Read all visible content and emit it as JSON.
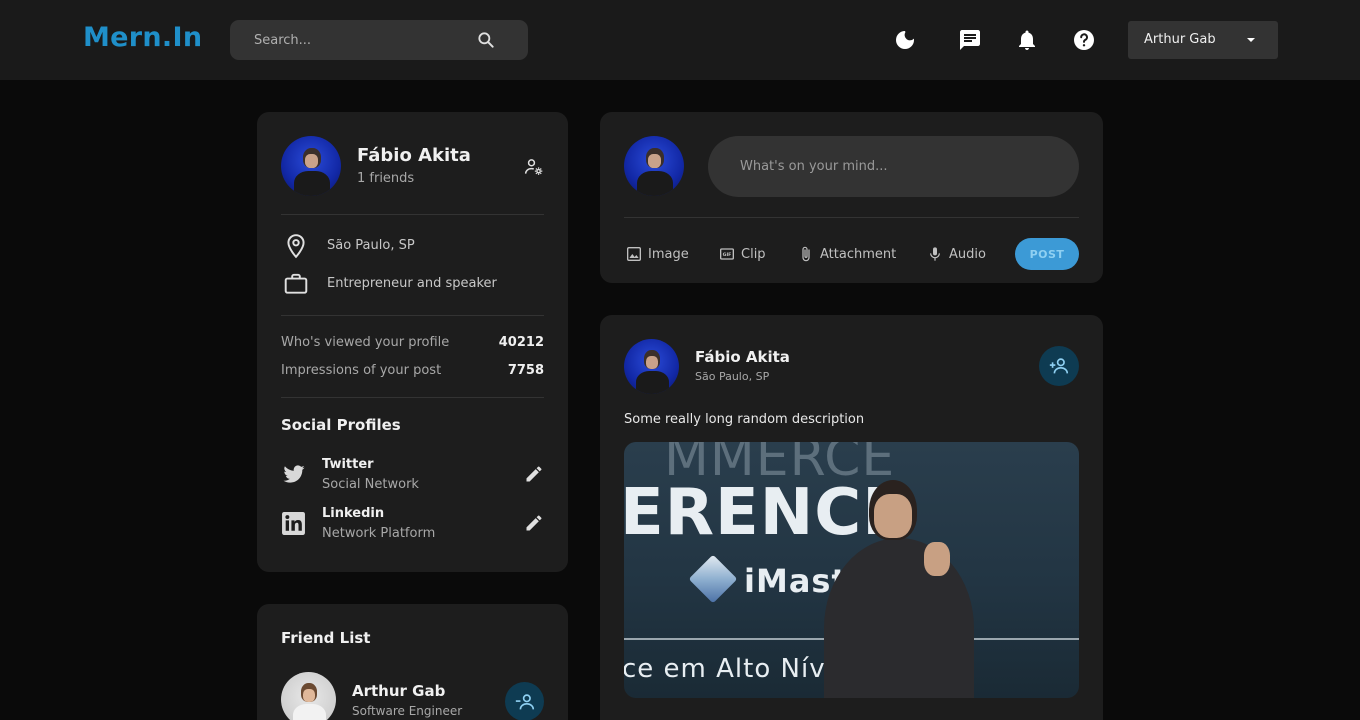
{
  "app": {
    "logo": "Mern.In"
  },
  "search": {
    "placeholder": "Search..."
  },
  "user_menu": {
    "selected": "Arthur Gab"
  },
  "profile": {
    "name": "Fábio Akita",
    "friends": "1 friends",
    "location": "São Paulo, SP",
    "occupation": "Entrepreneur and speaker",
    "stats": [
      {
        "label": "Who's viewed your profile",
        "value": "40212"
      },
      {
        "label": "Impressions of your post",
        "value": "7758"
      }
    ],
    "social_title": "Social Profiles",
    "social": [
      {
        "name": "Twitter",
        "type": "Social Network",
        "icon": "twitter-icon"
      },
      {
        "name": "Linkedin",
        "type": "Network Platform",
        "icon": "linkedin-icon"
      }
    ]
  },
  "friend_list": {
    "title": "Friend List",
    "friends": [
      {
        "name": "Arthur Gab",
        "subtitle": "Software Engineer"
      }
    ]
  },
  "composer": {
    "placeholder": "What's on your mind...",
    "actions": [
      "Image",
      "Clip",
      "Attachment",
      "Audio"
    ],
    "post_label": "POST"
  },
  "post": {
    "author": "Fábio Akita",
    "location": "São Paulo, SP",
    "description": "Some really long random description",
    "image_text": {
      "top": "MMERCE",
      "middle": "ERENCE",
      "brand": "iMast",
      "bottom": "ce em Alto Nív"
    }
  },
  "colors": {
    "accent": "#1f8fc9",
    "post_button": "#3c9ad6",
    "card": "#1d1d1d",
    "navbar": "#1a1a1a"
  }
}
